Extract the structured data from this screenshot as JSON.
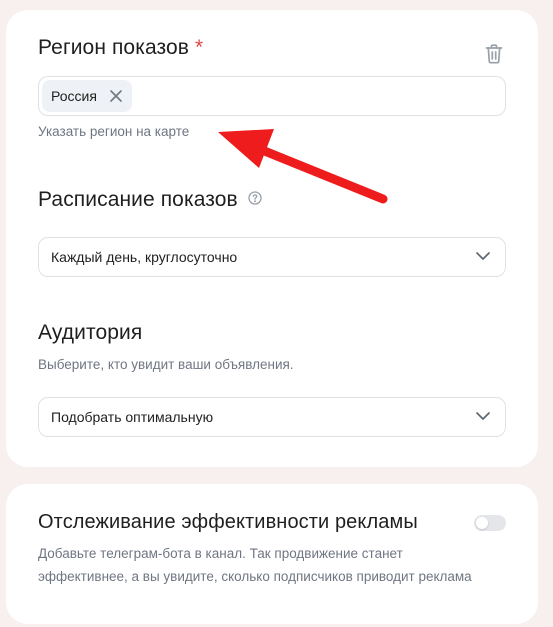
{
  "region": {
    "title": "Регион показов",
    "required_mark": "*",
    "selected": [
      {
        "label": "Россия"
      }
    ],
    "map_link": "Указать регион на карте"
  },
  "schedule": {
    "title": "Расписание показов",
    "value": "Каждый день, круглосуточно"
  },
  "audience": {
    "title": "Аудитория",
    "subtitle": "Выберите, кто увидит ваши объявления.",
    "value": "Подобрать оптимальную"
  },
  "tracking": {
    "title": "Отслеживание эффективности рекламы",
    "description_line1": "Добавьте телеграм-бота в канал. Так продвижение станет",
    "description_line2": "эффективнее, а вы увидите, сколько подписчиков приводит реклама",
    "toggle_on": false
  },
  "icons": {
    "trash": "trash-icon",
    "chip_close": "close-icon",
    "help": "question-circle-icon",
    "dropdown": "chevron-down-icon"
  },
  "colors": {
    "required": "#e04848",
    "annotation_arrow": "#ee1c1c",
    "page_background": "#f7f0ee"
  }
}
